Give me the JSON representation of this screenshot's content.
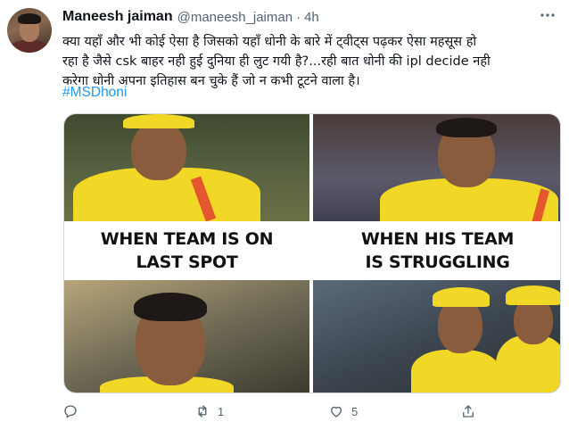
{
  "tweet": {
    "author": {
      "name": "Maneesh jaiman",
      "handle": "@maneesh_jaiman"
    },
    "separator": "·",
    "time": "4h",
    "text_lines": [
      "क्या यहाँ और भी कोई ऐसा है जिसको यहाँ धोनी के बारे में ट्वीट्स पढ़कर ऐसा महसूस हो",
      "रहा है जैसे csk बाहर नही हुई दुनिया ही लुट गयी है?...रही बात धोनी की ipl decide नही",
      "करेगा धोनी अपना इतिहास बन चुके हैं जो न कभी टूटने वाला है।"
    ],
    "hashtag": "#MSDhoni",
    "media": {
      "caption_left_line1": "WHEN TEAM IS ON",
      "caption_left_line2": "LAST SPOT",
      "caption_right_line1": "WHEN HIS TEAM",
      "caption_right_line2": "IS STRUGGLING"
    },
    "actions": {
      "reply_count": "",
      "retweet_count": "1",
      "like_count": "5"
    }
  },
  "icons": {
    "more": "more-icon",
    "reply": "reply-icon",
    "retweet": "retweet-icon",
    "like": "heart-icon",
    "share": "share-icon"
  },
  "colors": {
    "accent": "#1d9bf0",
    "secondary_text": "#536471",
    "jersey": "#f2d826"
  }
}
